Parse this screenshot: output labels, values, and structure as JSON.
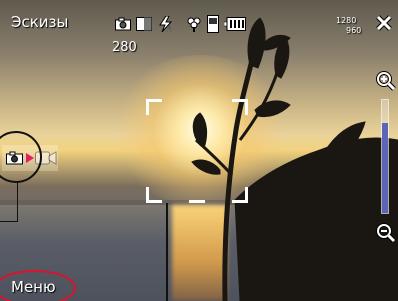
{
  "screen": {
    "title": "Эскизы",
    "shots_remaining": "280",
    "resolution": {
      "width": "1280",
      "height": "960"
    }
  },
  "status_icons": [
    "camera-icon",
    "white-balance-icon",
    "flash-auto-icon",
    "macro-icon",
    "storage-icon",
    "battery-icon"
  ],
  "zoom": {
    "level": 0.8
  },
  "mode_switch": {
    "current": "photo",
    "icons": [
      "camera-icon",
      "video-icon"
    ]
  },
  "softkeys": {
    "left": "Меню"
  },
  "colors": {
    "accent": "#5d66b6",
    "highlight_ellipse": "#e0102a",
    "mode_arrow": "#e02060"
  }
}
